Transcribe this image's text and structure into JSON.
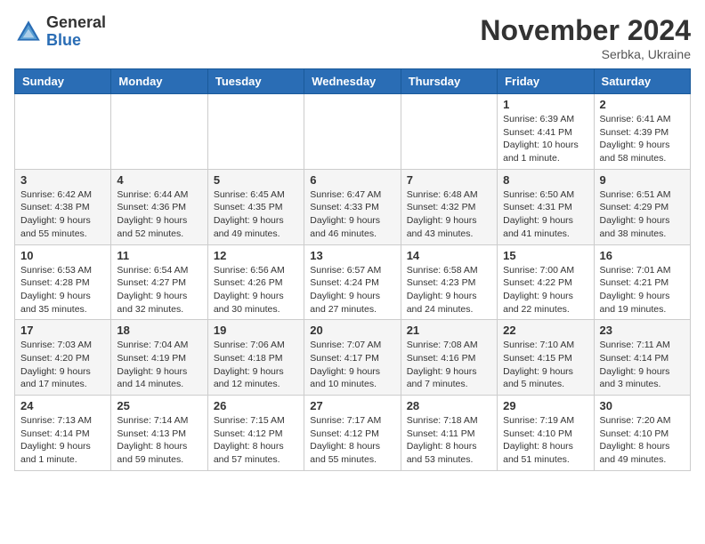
{
  "logo": {
    "general": "General",
    "blue": "Blue"
  },
  "title": "November 2024",
  "subtitle": "Serbka, Ukraine",
  "days_of_week": [
    "Sunday",
    "Monday",
    "Tuesday",
    "Wednesday",
    "Thursday",
    "Friday",
    "Saturday"
  ],
  "weeks": [
    [
      {
        "day": "",
        "info": ""
      },
      {
        "day": "",
        "info": ""
      },
      {
        "day": "",
        "info": ""
      },
      {
        "day": "",
        "info": ""
      },
      {
        "day": "",
        "info": ""
      },
      {
        "day": "1",
        "info": "Sunrise: 6:39 AM\nSunset: 4:41 PM\nDaylight: 10 hours and 1 minute."
      },
      {
        "day": "2",
        "info": "Sunrise: 6:41 AM\nSunset: 4:39 PM\nDaylight: 9 hours and 58 minutes."
      }
    ],
    [
      {
        "day": "3",
        "info": "Sunrise: 6:42 AM\nSunset: 4:38 PM\nDaylight: 9 hours and 55 minutes."
      },
      {
        "day": "4",
        "info": "Sunrise: 6:44 AM\nSunset: 4:36 PM\nDaylight: 9 hours and 52 minutes."
      },
      {
        "day": "5",
        "info": "Sunrise: 6:45 AM\nSunset: 4:35 PM\nDaylight: 9 hours and 49 minutes."
      },
      {
        "day": "6",
        "info": "Sunrise: 6:47 AM\nSunset: 4:33 PM\nDaylight: 9 hours and 46 minutes."
      },
      {
        "day": "7",
        "info": "Sunrise: 6:48 AM\nSunset: 4:32 PM\nDaylight: 9 hours and 43 minutes."
      },
      {
        "day": "8",
        "info": "Sunrise: 6:50 AM\nSunset: 4:31 PM\nDaylight: 9 hours and 41 minutes."
      },
      {
        "day": "9",
        "info": "Sunrise: 6:51 AM\nSunset: 4:29 PM\nDaylight: 9 hours and 38 minutes."
      }
    ],
    [
      {
        "day": "10",
        "info": "Sunrise: 6:53 AM\nSunset: 4:28 PM\nDaylight: 9 hours and 35 minutes."
      },
      {
        "day": "11",
        "info": "Sunrise: 6:54 AM\nSunset: 4:27 PM\nDaylight: 9 hours and 32 minutes."
      },
      {
        "day": "12",
        "info": "Sunrise: 6:56 AM\nSunset: 4:26 PM\nDaylight: 9 hours and 30 minutes."
      },
      {
        "day": "13",
        "info": "Sunrise: 6:57 AM\nSunset: 4:24 PM\nDaylight: 9 hours and 27 minutes."
      },
      {
        "day": "14",
        "info": "Sunrise: 6:58 AM\nSunset: 4:23 PM\nDaylight: 9 hours and 24 minutes."
      },
      {
        "day": "15",
        "info": "Sunrise: 7:00 AM\nSunset: 4:22 PM\nDaylight: 9 hours and 22 minutes."
      },
      {
        "day": "16",
        "info": "Sunrise: 7:01 AM\nSunset: 4:21 PM\nDaylight: 9 hours and 19 minutes."
      }
    ],
    [
      {
        "day": "17",
        "info": "Sunrise: 7:03 AM\nSunset: 4:20 PM\nDaylight: 9 hours and 17 minutes."
      },
      {
        "day": "18",
        "info": "Sunrise: 7:04 AM\nSunset: 4:19 PM\nDaylight: 9 hours and 14 minutes."
      },
      {
        "day": "19",
        "info": "Sunrise: 7:06 AM\nSunset: 4:18 PM\nDaylight: 9 hours and 12 minutes."
      },
      {
        "day": "20",
        "info": "Sunrise: 7:07 AM\nSunset: 4:17 PM\nDaylight: 9 hours and 10 minutes."
      },
      {
        "day": "21",
        "info": "Sunrise: 7:08 AM\nSunset: 4:16 PM\nDaylight: 9 hours and 7 minutes."
      },
      {
        "day": "22",
        "info": "Sunrise: 7:10 AM\nSunset: 4:15 PM\nDaylight: 9 hours and 5 minutes."
      },
      {
        "day": "23",
        "info": "Sunrise: 7:11 AM\nSunset: 4:14 PM\nDaylight: 9 hours and 3 minutes."
      }
    ],
    [
      {
        "day": "24",
        "info": "Sunrise: 7:13 AM\nSunset: 4:14 PM\nDaylight: 9 hours and 1 minute."
      },
      {
        "day": "25",
        "info": "Sunrise: 7:14 AM\nSunset: 4:13 PM\nDaylight: 8 hours and 59 minutes."
      },
      {
        "day": "26",
        "info": "Sunrise: 7:15 AM\nSunset: 4:12 PM\nDaylight: 8 hours and 57 minutes."
      },
      {
        "day": "27",
        "info": "Sunrise: 7:17 AM\nSunset: 4:12 PM\nDaylight: 8 hours and 55 minutes."
      },
      {
        "day": "28",
        "info": "Sunrise: 7:18 AM\nSunset: 4:11 PM\nDaylight: 8 hours and 53 minutes."
      },
      {
        "day": "29",
        "info": "Sunrise: 7:19 AM\nSunset: 4:10 PM\nDaylight: 8 hours and 51 minutes."
      },
      {
        "day": "30",
        "info": "Sunrise: 7:20 AM\nSunset: 4:10 PM\nDaylight: 8 hours and 49 minutes."
      }
    ]
  ]
}
